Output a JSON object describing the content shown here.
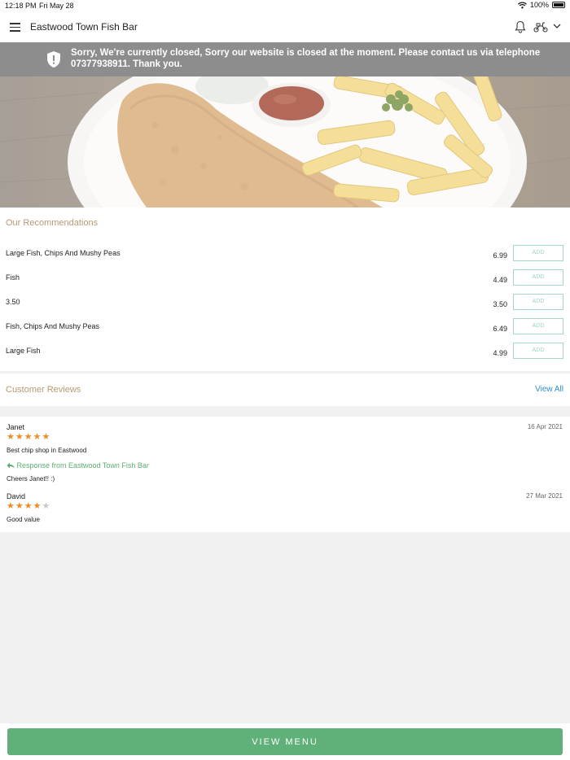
{
  "status_bar": {
    "time": "12:18 PM",
    "date": "Fri May 28",
    "battery": "100%"
  },
  "header": {
    "title": "Eastwood Town Fish Bar",
    "menu_icon": "hamburger-icon",
    "bell_icon": "bell-icon",
    "delivery_icon": "scooter-icon",
    "dropdown_icon": "chevron-down-icon"
  },
  "banner": {
    "text": "Sorry, We're currently closed, Sorry our website is closed at the moment. Please contact us via telephone 07377938911. Thank you.",
    "icon": "shield-alert-icon"
  },
  "hero": {
    "description_icon": "fish-and-chips-image"
  },
  "recommendations": {
    "title": "Our Recommendations",
    "add_label": "ADD",
    "items": [
      {
        "name": "Large Fish, Chips And Mushy Peas",
        "price": "6.99"
      },
      {
        "name": "Fish",
        "price": "4.49"
      },
      {
        "name": "3.50",
        "price": "3.50"
      },
      {
        "name": "Fish, Chips And Mushy Peas",
        "price": "6.49"
      },
      {
        "name": "Large Fish",
        "price": "4.99"
      }
    ]
  },
  "reviews": {
    "title": "Customer Reviews",
    "view_all": "View All",
    "items": [
      {
        "name": "Janet",
        "date": "16 Apr 2021",
        "rating": 5,
        "text": "Best chip shop in Eastwood",
        "response_label": "Response from Eastwood Town Fish Bar",
        "response_text": "Cheers Janet!! :)"
      },
      {
        "name": "David",
        "date": "27 Mar 2021",
        "rating": 4,
        "text": "Good value"
      }
    ]
  },
  "footer": {
    "view_menu": "VIEW MENU"
  },
  "colors": {
    "accent_green": "#5fb179",
    "section_title": "#b59a72",
    "link_blue": "#2e8fd0",
    "star": "#f08a24",
    "banner_gray": "#8d8d8d"
  }
}
